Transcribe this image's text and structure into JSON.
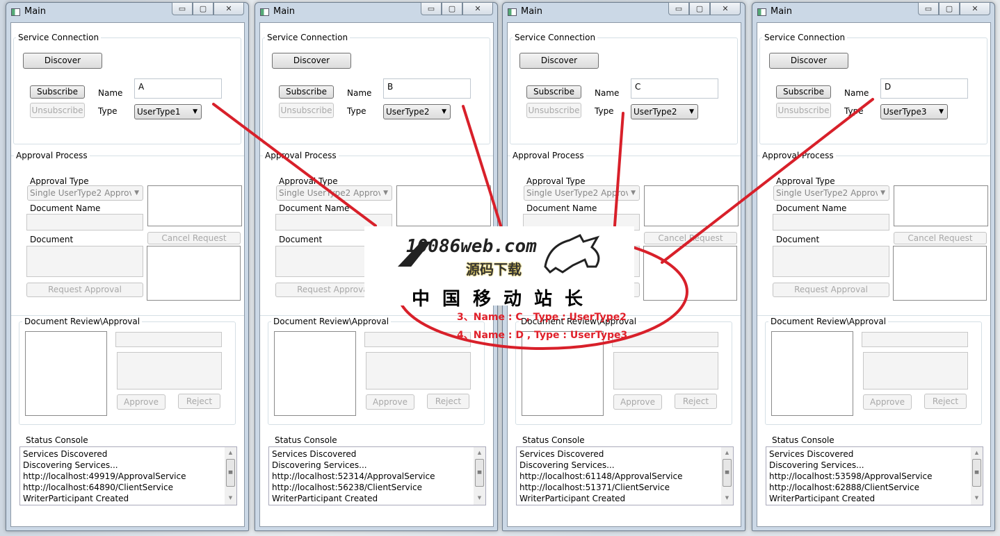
{
  "window_title": "Main",
  "caption": {
    "minimize": "▭",
    "maximize": "▢",
    "close": "✕"
  },
  "labels": {
    "service_connection": "Service Connection",
    "discover": "Discover",
    "subscribe": "Subscribe",
    "unsubscribe": "Unsubscribe",
    "name": "Name",
    "type": "Type",
    "approval_process": "Approval Process",
    "approval_type": "Approval Type",
    "approval_type_value": "Single UserType2 Approv",
    "document_name": "Document Name",
    "document": "Document",
    "cancel_request": "Cancel Request",
    "request_approval": "Request Approval",
    "document_review": "Document Review\\Approval",
    "approve": "Approve",
    "reject": "Reject",
    "status_console": "Status Console"
  },
  "windows": [
    {
      "name": "A",
      "type": "UserType1",
      "console": [
        "Services Discovered",
        "Discovering Services...",
        "http://localhost:49919/ApprovalService",
        "http://localhost:64890/ClientService",
        "WriterParticipant Created"
      ]
    },
    {
      "name": "B",
      "type": "UserType2",
      "console": [
        "Services Discovered",
        "Discovering Services...",
        "http://localhost:52314/ApprovalService",
        "http://localhost:56238/ClientService",
        "WriterParticipant Created"
      ]
    },
    {
      "name": "C",
      "type": "UserType2",
      "console": [
        "Services Discovered",
        "Discovering Services...",
        "http://localhost:61148/ApprovalService",
        "http://localhost:51371/ClientService",
        "WriterParticipant Created"
      ]
    },
    {
      "name": "D",
      "type": "UserType3",
      "console": [
        "Services Discovered",
        "Discovering Services...",
        "http://localhost:53598/ApprovalService",
        "http://localhost:62888/ClientService",
        "WriterParticipant Created"
      ]
    }
  ],
  "watermark": {
    "site": "10086web.com",
    "subtitle": "源码下载",
    "slogan": "中国移动站长"
  },
  "annotations": [
    "3、Name : C , Type : UserType2",
    "4、Name : D , Type : UserType3"
  ],
  "colors": {
    "annotation": "#e0202a"
  }
}
